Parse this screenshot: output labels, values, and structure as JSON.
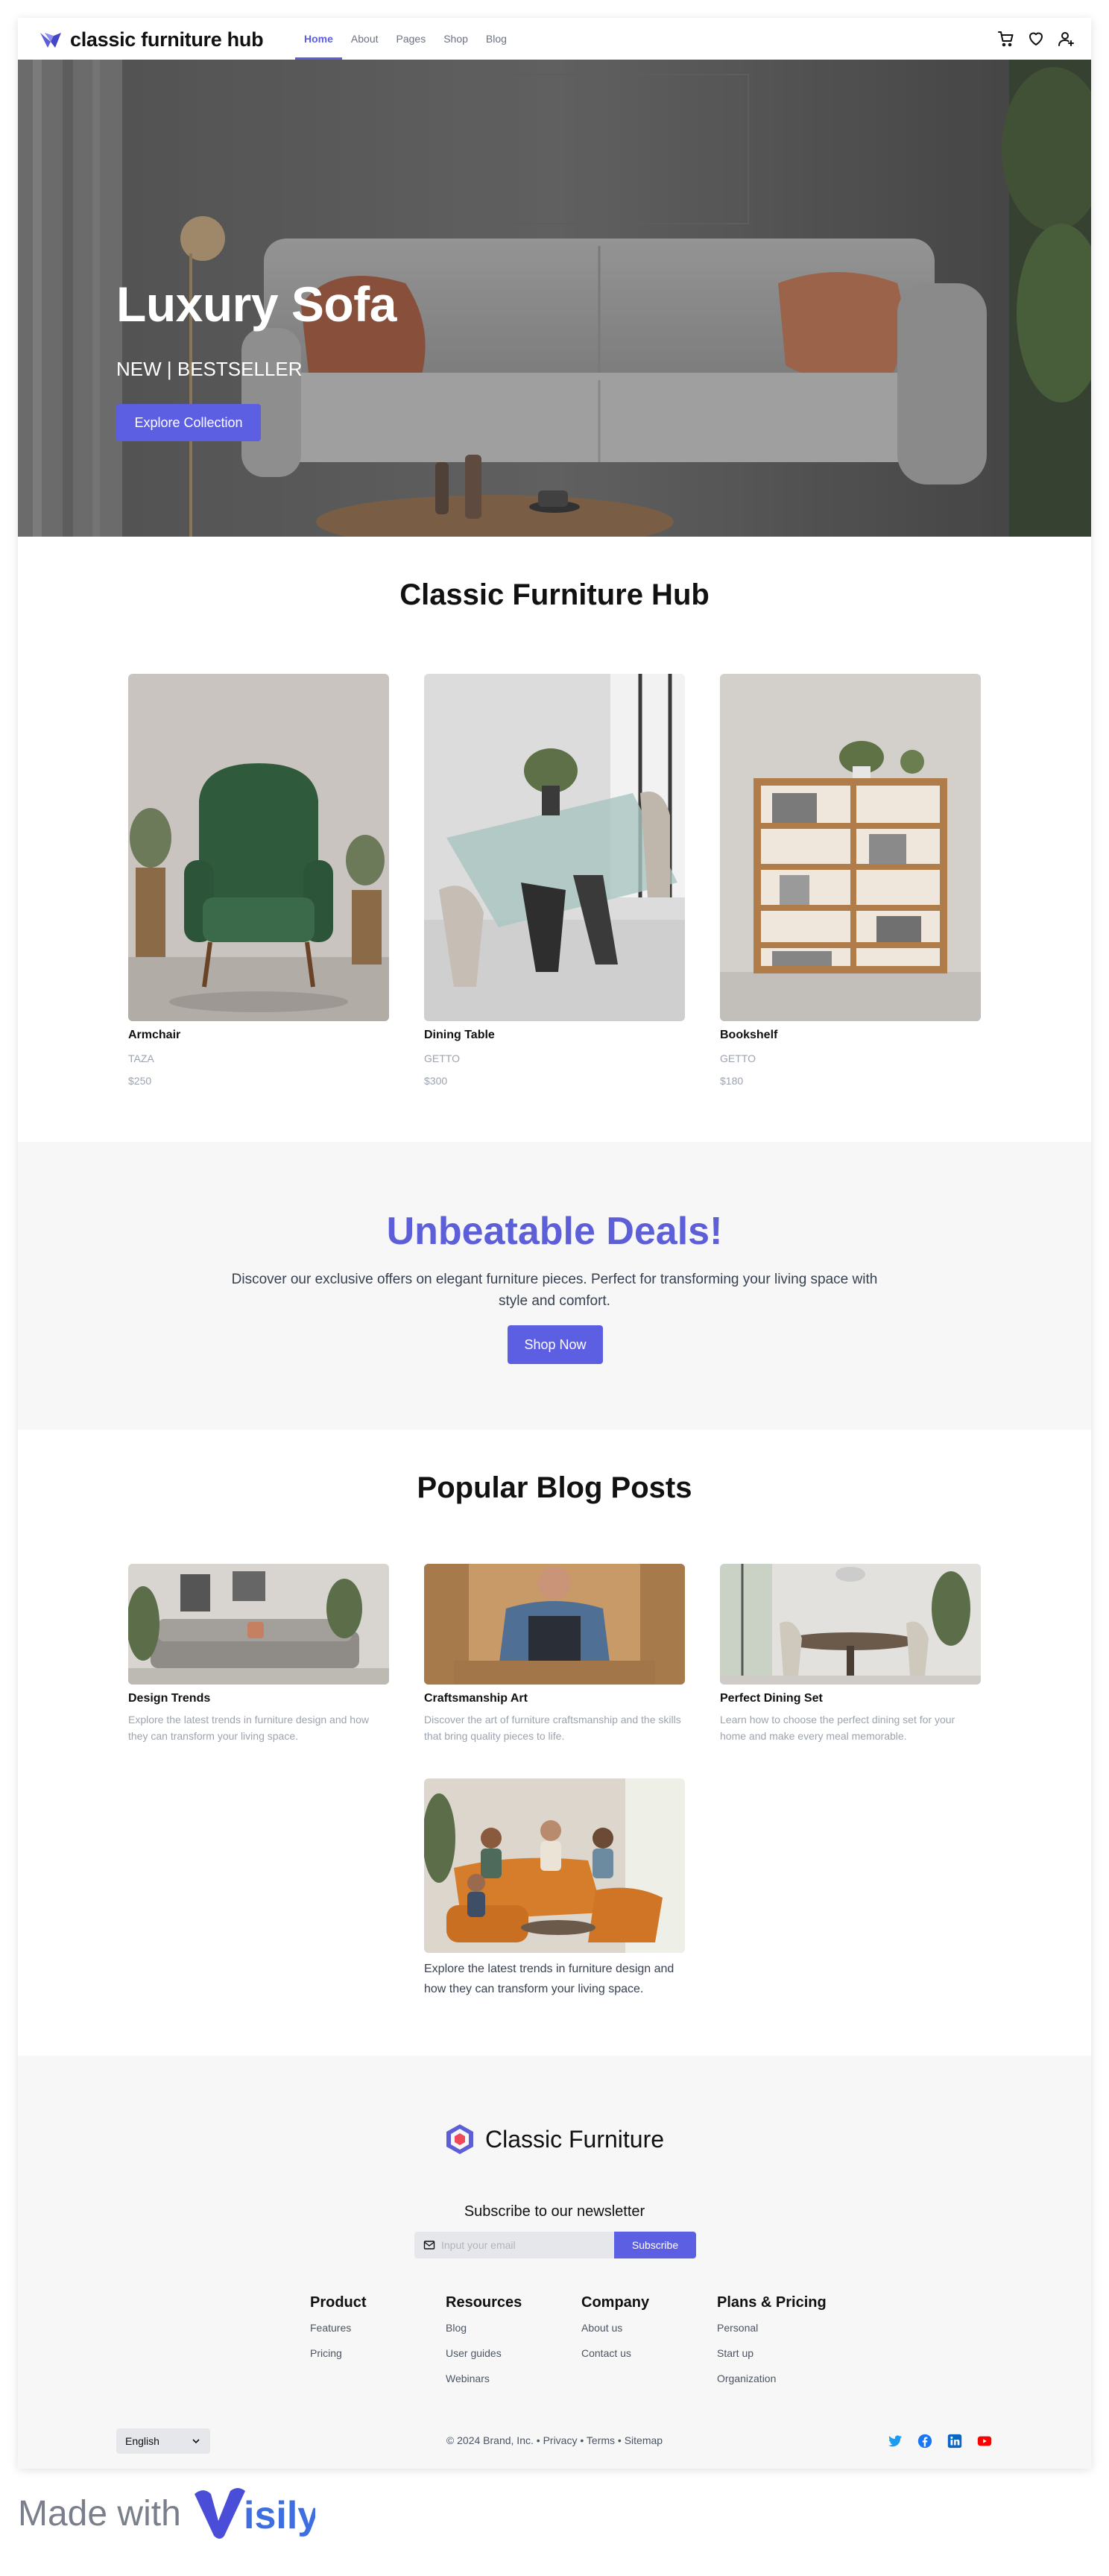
{
  "header": {
    "brand": "classic furniture hub",
    "nav": [
      "Home",
      "About",
      "Pages",
      "Shop",
      "Blog"
    ],
    "active_nav": "Home",
    "icons": [
      "cart-icon",
      "heart-icon",
      "user-icon"
    ]
  },
  "hero": {
    "title": "Luxury Sofa",
    "subtitle": "NEW | BESTSELLER",
    "button": "Explore Collection"
  },
  "products": {
    "title": "Classic Furniture Hub",
    "items": [
      {
        "name": "Armchair",
        "brand": "TAZA",
        "price": "$250"
      },
      {
        "name": "Dining Table",
        "brand": "GETTO",
        "price": "$300"
      },
      {
        "name": "Bookshelf",
        "brand": "GETTO",
        "price": "$180"
      }
    ]
  },
  "deals": {
    "title": "Unbeatable Deals!",
    "text": "Discover our exclusive offers on elegant furniture pieces. Perfect for transforming your living space with style and comfort.",
    "button": "Shop Now"
  },
  "blog": {
    "title": "Popular Blog Posts",
    "posts": [
      {
        "title": "Design Trends",
        "text": "Explore the latest trends in furniture design and how they can transform your living space."
      },
      {
        "title": "Craftsmanship Art",
        "text": "Discover the art of furniture craftsmanship and the skills that bring quality pieces to life."
      },
      {
        "title": "Perfect Dining Set",
        "text": "Learn how to choose the perfect dining set for your home and make every meal memorable."
      }
    ],
    "featured_text": "Explore the latest trends in furniture design and how they can transform your living space."
  },
  "footer": {
    "brand": "Classic Furniture",
    "newsletter_title": "Subscribe to our newsletter",
    "email_placeholder": "Input your email",
    "subscribe_button": "Subscribe",
    "columns": [
      {
        "title": "Product",
        "links": [
          "Features",
          "Pricing"
        ]
      },
      {
        "title": "Resources",
        "links": [
          "Blog",
          "User guides",
          "Webinars"
        ]
      },
      {
        "title": "Company",
        "links": [
          "About us",
          "Contact us"
        ]
      },
      {
        "title": "Plans & Pricing",
        "links": [
          "Personal",
          "Start up",
          "Organization"
        ]
      }
    ],
    "language": "English",
    "copyright": "© 2024 Brand, Inc.",
    "legal_links": [
      "Privacy",
      "Terms",
      "Sitemap"
    ],
    "social": [
      "twitter-icon",
      "facebook-icon",
      "linkedin-icon",
      "youtube-icon"
    ],
    "colors": {
      "accent": "#5d5fe3",
      "twitter": "#1d9bf0",
      "facebook": "#1877f2",
      "linkedin": "#0a66c2",
      "youtube": "#ff0000"
    }
  },
  "madewith": {
    "text": "Made with",
    "logo": "isily"
  }
}
